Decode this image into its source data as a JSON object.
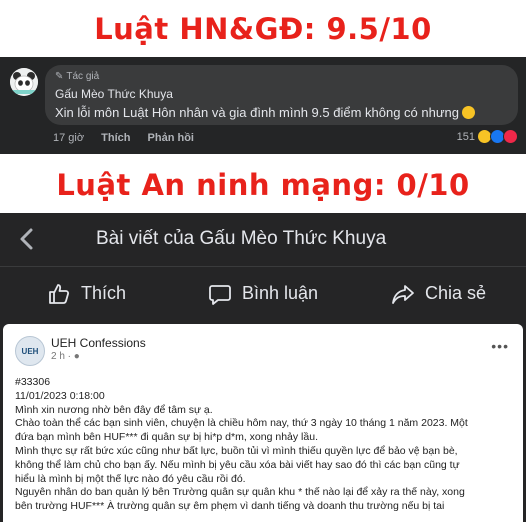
{
  "headlines": {
    "top": "Luật HN&GĐ: 9.5/10",
    "middle": "Luật An ninh mạng: 0/10"
  },
  "comment": {
    "author_tag": "Tác giả",
    "author_name": "Gấu Mèo Thức Khuya",
    "text": "Xin lỗi môn Luật Hôn nhân và gia đình mình 9.5 điểm không có nhưng",
    "time": "17 giờ",
    "like_label": "Thích",
    "reply_label": "Phản hồi",
    "reaction_count": "151",
    "reaction_icons": [
      "haha",
      "like",
      "love"
    ]
  },
  "mobile": {
    "title": "Bài viết của Gấu Mèo Thức Khuya",
    "actions": {
      "like": "Thích",
      "comment": "Bình luận",
      "share": "Chia sẻ"
    },
    "post": {
      "avatar_text": "UEH",
      "page_name": "UEH Confessions",
      "time": "2 h ·",
      "body_lines": [
        "#33306",
        "11/01/2023 0:18:00",
        "Mình xin nương nhờ bên đây để tâm sự ạ.",
        "Chào toàn thể các bạn sinh viên, chuyện là chiều hôm nay, thứ 3 ngày 10 tháng 1 năm 2023. Một",
        "đứa bạn mình bên HUF*** đi quân sự bị hi*p d*m, xong nhảy lầu.",
        "Mình thực sự rất bức xúc cũng như bất lực, buồn tủi vì mình thiếu quyền lực để bảo vệ bạn bè,",
        "không thể làm chủ cho bạn ấy. Nếu mình bị yêu cầu xóa bài viết hay sao đó thì các bạn cũng tự",
        "hiểu là mình bị một thế lực nào đó yêu cầu rồi đó.",
        "Nguyên nhân do ban quản lý bên Trường quân sự quân khu * thế nào lại để xảy ra thế này, xong",
        "bên trường HUF*** À trường quân sự êm phẹm vì danh tiếng và doanh thu trường nếu bị tai"
      ]
    }
  },
  "colors": {
    "headline_red": "#e8221b",
    "dark_panel": "#242526",
    "bubble": "#3a3b3c"
  }
}
